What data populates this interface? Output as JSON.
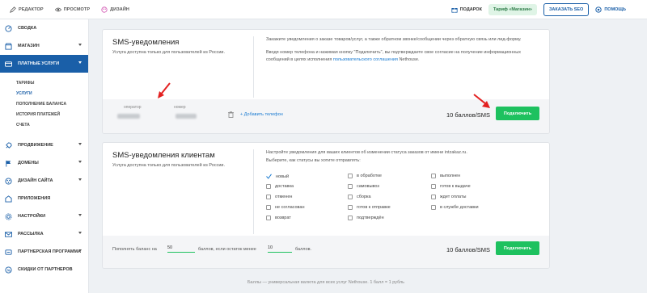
{
  "topbar": {
    "editor": "РЕДАКТОР",
    "preview": "ПРОСМОТР",
    "design": "ДИЗАЙН",
    "gifts": "ПОДАРОК",
    "tariff": "Тариф «Магазин»",
    "order_seo": "ЗАКАЗАТЬ SEO",
    "help": "ПОМОЩЬ"
  },
  "sidebar": {
    "items": [
      {
        "label": "СВОДКА",
        "icon": "gauge-icon"
      },
      {
        "label": "МАГАЗИН",
        "icon": "shop-icon"
      },
      {
        "label": "ПЛАТНЫЕ УСЛУГИ",
        "icon": "card-icon"
      },
      {
        "label": "ПРОДВИЖЕНИЕ",
        "icon": "rocket-icon"
      },
      {
        "label": "ДОМЕНЫ",
        "icon": "flag-icon"
      },
      {
        "label": "ДИЗАЙН САЙТА",
        "icon": "palette-icon"
      },
      {
        "label": "ПРИЛОЖЕНИЯ",
        "icon": "apps-icon"
      },
      {
        "label": "НАСТРОЙКИ",
        "icon": "settings-icon"
      },
      {
        "label": "РАССЫЛКА",
        "icon": "mail-icon"
      },
      {
        "label": "ПАРТНЕРСКАЯ ПРОГРАММА",
        "icon": "partner-icon"
      },
      {
        "label": "СКИДКИ ОТ ПАРТНЕРОВ",
        "icon": "discount-icon"
      }
    ],
    "subitems": [
      "ТАРИФЫ",
      "УСЛУГИ",
      "ПОПОЛНЕНИЕ БАЛАНСА",
      "ИСТОРИЯ ПЛАТЕЖЕЙ",
      "СЧЕТА"
    ]
  },
  "sms": {
    "title": "SMS-уведомления",
    "subtitle": "Услуга доступна только для пользователей из России.",
    "desc1": "Закажите уведомления о заказе товаров/услуг, а также обратном звонке/сообщении через обратную связь или лид-форму.",
    "desc2_a": "Вводя номер телефона и нажимая кнопку \"Подключить\", вы подтверждаете свое согласие на получение информационных сообщений в целях исполнения ",
    "desc2_link": "пользовательского соглашения",
    "desc2_b": " Nethouse.",
    "operator_label": "оператор",
    "number_label": "номер",
    "add_phone": "+ Добавить телефон",
    "price": "10 баллов/SMS",
    "connect": "Подключить"
  },
  "sms_clients": {
    "title": "SMS-уведомления клиентам",
    "subtitle": "Услуга доступна только для пользователей из России.",
    "desc1": "Настройте уведомления для ваших клиентов об изменении статуса заказов от имени intzakaz.ru.",
    "desc2": "Выберите, как статусы вы хотите отправлять:",
    "statuses": [
      {
        "label": "новый",
        "checked": true
      },
      {
        "label": "в обработке",
        "checked": false
      },
      {
        "label": "выполнен",
        "checked": false
      },
      {
        "label": "доставка",
        "checked": false
      },
      {
        "label": "самовывоз",
        "checked": false
      },
      {
        "label": "готов к выдаче",
        "checked": false
      },
      {
        "label": "отменен",
        "checked": false
      },
      {
        "label": "сборка",
        "checked": false
      },
      {
        "label": "ждет оплаты",
        "checked": false
      },
      {
        "label": "не согласован",
        "checked": false
      },
      {
        "label": "готов к отправке",
        "checked": false
      },
      {
        "label": "в службе доставки",
        "checked": false
      },
      {
        "label": "возврат",
        "checked": false
      },
      {
        "label": "подтверждён",
        "checked": false
      }
    ],
    "refill_prefix": "Пополнять баланс на",
    "refill_amount": "50",
    "refill_middle": "баллов, если остаток менее",
    "refill_threshold": "10",
    "refill_suffix": "баллов.",
    "price": "10 баллов/SMS",
    "connect": "Подключить"
  },
  "footer_note": "Баллы — универсальная валюта для всех услуг Nethouse. 1 балл = 1 рубль",
  "colors": {
    "primary": "#1a5fa8",
    "green": "#1ec15f",
    "annotation": "#e32020"
  }
}
